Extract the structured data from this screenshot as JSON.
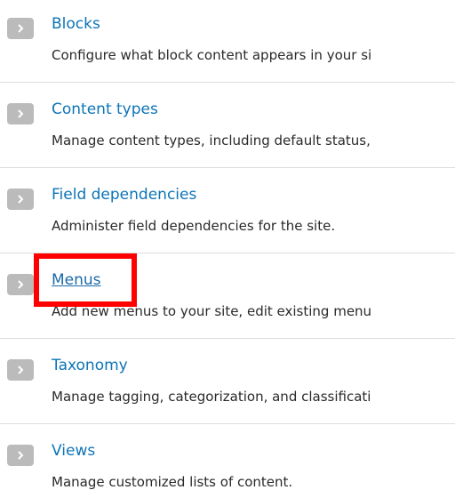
{
  "items": [
    {
      "title": "Blocks",
      "description": "Configure what block content appears in your si"
    },
    {
      "title": "Content types",
      "description": "Manage content types, including default status,"
    },
    {
      "title": "Field dependencies",
      "description": "Administer field dependencies for the site."
    },
    {
      "title": "Menus",
      "description": "Add new menus to your site, edit existing menu"
    },
    {
      "title": "Taxonomy",
      "description": "Manage tagging, categorization, and classificati"
    },
    {
      "title": "Views",
      "description": "Manage customized lists of content."
    }
  ],
  "highlight": {
    "color": "#ff0000",
    "target": "Menus"
  },
  "colors": {
    "link": "#0d74b6",
    "arrow_bg": "#bbbbbb",
    "text": "#2a2a2a"
  }
}
